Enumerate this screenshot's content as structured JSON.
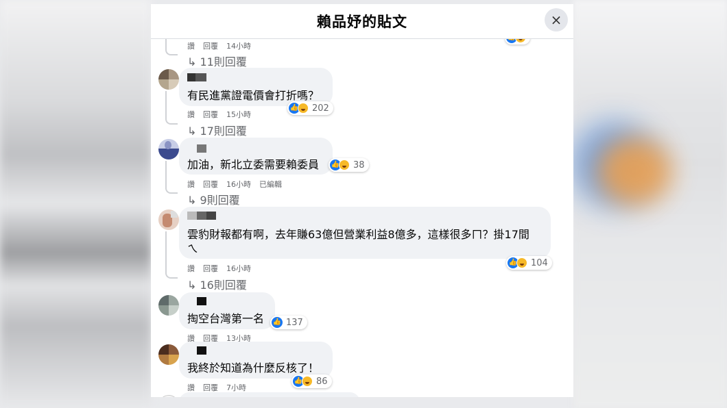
{
  "dialog": {
    "title": "賴品妤的貼文",
    "close_icon": "×"
  },
  "top_partial": {
    "meta": [
      "讚",
      "回覆",
      "14小時"
    ],
    "replies": "↳ 11則回覆"
  },
  "comments": [
    {
      "text": "有民進黨證電價會打折嗎？",
      "meta": [
        "讚",
        "回覆",
        "15小時"
      ],
      "reactions": [
        "like",
        "haha"
      ],
      "count": "202",
      "replies": "↳ 17則回覆"
    },
    {
      "text": "加油，新北立委需要賴委員",
      "meta": [
        "讚",
        "回覆",
        "16小時",
        "已編輯"
      ],
      "reactions": [
        "like",
        "haha"
      ],
      "count": "38",
      "replies": "↳ 9則回覆"
    },
    {
      "text_line1": "雲豹財報都有啊，去年賺63億但營業利益8億多，這樣很多ㄇ？掛17間",
      "text_line2": "ㄟ",
      "meta": [
        "讚",
        "回覆",
        "16小時"
      ],
      "reactions": [
        "like",
        "haha"
      ],
      "count": "104",
      "replies": "↳ 16則回覆"
    },
    {
      "text": "掏空台灣第一名",
      "meta": [
        "讚",
        "回覆",
        "13小時"
      ],
      "reactions": [
        "like"
      ],
      "count": "137"
    },
    {
      "text": "我終於知道為什麼反核了！",
      "meta": [
        "讚",
        "回覆",
        "7小時"
      ],
      "reactions": [
        "like",
        "haha"
      ],
      "count": "86"
    }
  ],
  "colors": {
    "like": "#1877f2",
    "haha": "#f7b928",
    "bubble": "#f0f2f5",
    "meta_text": "#65676b"
  }
}
